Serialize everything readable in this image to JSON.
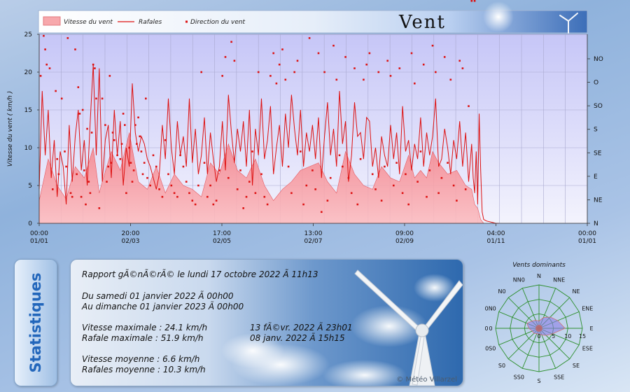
{
  "header": {
    "title": "Vent",
    "legend": {
      "speed": "Vitesse du vent",
      "gusts": "Rafales",
      "direction": "Direction du vent"
    }
  },
  "chart_data": [
    {
      "type": "area",
      "ylabel": "Vitesse du vent  ( km/h )",
      "ylim": [
        0,
        25
      ],
      "y_ticks": [
        0,
        5,
        10,
        15,
        20,
        25
      ],
      "x_ticks": [
        {
          "time": "00:00",
          "date": "01/01"
        },
        {
          "time": "20:00",
          "date": "02/03"
        },
        {
          "time": "17:00",
          "date": "02/05"
        },
        {
          "time": "13:00",
          "date": "02/07"
        },
        {
          "time": "09:00",
          "date": "02/09"
        },
        {
          "time": "04:00",
          "date": "01/11"
        },
        {
          "time": "00:00",
          "date": "01/01"
        }
      ],
      "right_axis_ticks": [
        "N",
        "NE",
        "E",
        "SE",
        "S",
        "SO",
        "O",
        "NO"
      ],
      "grid": true,
      "legend_position": "top",
      "colors": {
        "speed_fill": "#f48a8f",
        "gusts": "#dd1111",
        "direction": "#dd1111",
        "plot_bg_top": "#c8c8f7",
        "plot_bg_bottom": "#eeeefc"
      },
      "series": [
        {
          "name": "Vitesse du vent",
          "kind": "area",
          "x_day": [
            0,
            6,
            12,
            18,
            24,
            30,
            36,
            40,
            42,
            48,
            54,
            60,
            66,
            72,
            78,
            84,
            90,
            96,
            102,
            108,
            114,
            120,
            126,
            132,
            138,
            144,
            150,
            156,
            162,
            168,
            174,
            180,
            186,
            192,
            198,
            204,
            210,
            216,
            222,
            228,
            234,
            240,
            246,
            250,
            254,
            258,
            262,
            266,
            272,
            278,
            284,
            288,
            290,
            292,
            294,
            296
          ],
          "values": [
            3.0,
            8.5,
            5.0,
            3.2,
            7.5,
            6.0,
            10.0,
            4.0,
            5.5,
            9.5,
            7.0,
            12.0,
            5.5,
            4.5,
            7.5,
            4.0,
            6.5,
            5.0,
            4.5,
            3.5,
            8.0,
            6.5,
            10.5,
            7.0,
            6.0,
            8.5,
            5.0,
            3.0,
            4.5,
            5.5,
            7.0,
            7.5,
            8.0,
            5.5,
            4.0,
            9.5,
            6.5,
            5.0,
            4.5,
            7.5,
            6.0,
            5.5,
            9.0,
            6.0,
            7.0,
            6.0,
            9.5,
            8.0,
            6.5,
            7.0,
            5.0,
            4.5,
            2.5,
            2.0,
            0.5,
            0.0
          ]
        },
        {
          "name": "Rafales",
          "kind": "line",
          "x_day": [
            0,
            2,
            4,
            6,
            8,
            10,
            12,
            14,
            16,
            18,
            20,
            22,
            24,
            26,
            28,
            30,
            32,
            34,
            36,
            38,
            40,
            42,
            44,
            46,
            48,
            50,
            52,
            54,
            56,
            58,
            60,
            62,
            64,
            66,
            68,
            70,
            72,
            74,
            76,
            78,
            80,
            82,
            84,
            86,
            88,
            90,
            92,
            94,
            96,
            98,
            100,
            102,
            104,
            106,
            108,
            110,
            112,
            114,
            116,
            118,
            120,
            122,
            124,
            126,
            128,
            130,
            132,
            134,
            136,
            138,
            140,
            142,
            144,
            146,
            148,
            150,
            152,
            154,
            156,
            158,
            160,
            162,
            164,
            166,
            168,
            170,
            172,
            174,
            176,
            178,
            180,
            182,
            184,
            186,
            188,
            190,
            192,
            194,
            196,
            198,
            200,
            202,
            204,
            206,
            208,
            210,
            212,
            214,
            216,
            218,
            220,
            222,
            224,
            226,
            228,
            230,
            232,
            234,
            236,
            238,
            240,
            242,
            244,
            246,
            248,
            250,
            252,
            254,
            256,
            258,
            260,
            262,
            264,
            266,
            268,
            270,
            272,
            274,
            276,
            278,
            280,
            282,
            284,
            286,
            288,
            289,
            290,
            291,
            292,
            293,
            294,
            295,
            296,
            298,
            300,
            302,
            304,
            306
          ],
          "values": [
            4.5,
            17.5,
            9.0,
            15.0,
            6.0,
            11.0,
            3.5,
            9.5,
            7.5,
            2.5,
            13.0,
            5.5,
            11.5,
            15.0,
            7.0,
            11.0,
            5.0,
            13.5,
            21.0,
            9.0,
            20.5,
            5.5,
            11.0,
            13.0,
            6.0,
            15.0,
            9.0,
            13.5,
            5.0,
            10.0,
            7.5,
            18.5,
            12.0,
            9.5,
            11.5,
            10.5,
            8.5,
            7.5,
            6.0,
            4.5,
            6.5,
            13.0,
            8.5,
            16.5,
            10.0,
            6.5,
            13.5,
            9.0,
            11.5,
            7.5,
            16.5,
            8.0,
            12.5,
            6.5,
            9.0,
            14.0,
            6.5,
            12.0,
            8.5,
            5.5,
            7.5,
            13.5,
            7.0,
            17.0,
            12.0,
            8.0,
            12.5,
            9.5,
            13.5,
            7.5,
            15.0,
            5.0,
            12.5,
            9.0,
            16.5,
            8.5,
            11.0,
            15.5,
            6.5,
            10.0,
            13.0,
            7.5,
            14.5,
            10.0,
            17.0,
            12.5,
            9.0,
            15.0,
            7.5,
            12.0,
            9.5,
            13.0,
            8.5,
            14.0,
            6.0,
            11.5,
            16.0,
            9.0,
            12.5,
            7.5,
            17.5,
            10.5,
            13.5,
            5.5,
            9.0,
            16.0,
            11.5,
            12.0,
            8.5,
            14.0,
            13.5,
            7.5,
            10.0,
            6.0,
            11.5,
            9.0,
            7.5,
            13.0,
            8.5,
            12.0,
            6.5,
            15.5,
            9.5,
            11.0,
            7.0,
            10.5,
            8.5,
            14.0,
            7.5,
            12.0,
            9.0,
            11.5,
            16.5,
            7.5,
            8.5,
            12.5,
            10.0,
            6.5,
            11.0,
            8.5,
            13.5,
            7.5,
            12.0,
            5.5,
            10.5,
            6.0,
            4.0,
            9.5,
            2.5,
            14.5,
            7.0,
            1.5,
            0.5,
            0.3,
            0.2,
            0.1,
            0.0,
            0.0
          ]
        },
        {
          "name": "Direction du vent",
          "kind": "scatter",
          "x_day": [
            1,
            3,
            4,
            5,
            7,
            9,
            11,
            12,
            13,
            15,
            17,
            18,
            19,
            21,
            22,
            24,
            25,
            26,
            27,
            28,
            29,
            30,
            31,
            32,
            33,
            34,
            35,
            36,
            37,
            38,
            40,
            42,
            44,
            45,
            46,
            47,
            48,
            49,
            50,
            52,
            54,
            55,
            56,
            57,
            58,
            60,
            61,
            62,
            63,
            64,
            65,
            66,
            67,
            68,
            69,
            70,
            71,
            72,
            74,
            76,
            78,
            80,
            82,
            84,
            86,
            88,
            90,
            92,
            94,
            96,
            98,
            100,
            102,
            104,
            106,
            108,
            110,
            112,
            114,
            116,
            118,
            120,
            122,
            124,
            126,
            128,
            130,
            132,
            134,
            136,
            138,
            140,
            142,
            144,
            146,
            148,
            150,
            152,
            154,
            156,
            158,
            160,
            162,
            164,
            166,
            168,
            170,
            172,
            174,
            176,
            178,
            180,
            182,
            184,
            186,
            188,
            190,
            192,
            194,
            196,
            198,
            200,
            202,
            204,
            206,
            208,
            210,
            212,
            214,
            216,
            218,
            220,
            222,
            224,
            226,
            228,
            230,
            232,
            234,
            236,
            238,
            240,
            242,
            244,
            246,
            248,
            250,
            252,
            254,
            256,
            258,
            260,
            262,
            264,
            266,
            268,
            270,
            272,
            274,
            276,
            278,
            280,
            282,
            284,
            286,
            288,
            290
          ],
          "values": [
            19.5,
            24.8,
            23.0,
            21.0,
            20.5,
            4.5,
            17.5,
            8.5,
            6.5,
            16.5,
            9.5,
            7.5,
            24.5,
            4.0,
            3.5,
            23.0,
            6.5,
            18.0,
            14.5,
            3.5,
            15.0,
            7.0,
            2.5,
            12.5,
            5.5,
            4.0,
            12.0,
            21.0,
            20.5,
            16.5,
            2.0,
            16.5,
            13.0,
            5.5,
            7.5,
            19.5,
            8.0,
            12.0,
            11.0,
            9.0,
            8.5,
            10.5,
            14.5,
            13.0,
            4.0,
            10.0,
            8.0,
            5.5,
            7.0,
            13.0,
            10.5,
            14.0,
            11.5,
            9.5,
            6.5,
            8.0,
            16.5,
            6.0,
            5.0,
            9.0,
            7.5,
            4.5,
            3.5,
            11.0,
            6.5,
            5.0,
            4.0,
            3.5,
            9.0,
            7.5,
            5.5,
            4.0,
            3.0,
            2.5,
            5.0,
            20.0,
            8.0,
            3.5,
            5.0,
            2.5,
            3.0,
            7.0,
            19.5,
            22.0,
            6.0,
            24.0,
            21.5,
            4.5,
            7.0,
            2.0,
            3.5,
            5.5,
            9.5,
            4.0,
            20.0,
            6.5,
            3.5,
            2.5,
            19.5,
            22.5,
            18.5,
            21.0,
            23.0,
            19.0,
            7.5,
            4.0,
            20.0,
            21.5,
            9.5,
            2.5,
            5.0,
            24.5,
            7.0,
            4.5,
            22.5,
            1.5,
            20.0,
            3.0,
            6.0,
            23.5,
            19.0,
            9.0,
            7.5,
            22.0,
            6.0,
            4.0,
            20.5,
            2.5,
            8.5,
            19.0,
            21.0,
            22.5,
            6.5,
            4.5,
            20.0,
            3.0,
            7.5,
            21.5,
            19.5,
            5.0,
            8.0,
            20.5,
            4.0,
            6.5,
            2.5,
            22.5,
            18.5,
            5.5,
            9.5,
            21.0,
            3.5,
            7.0,
            23.5,
            20.0,
            4.0,
            6.0,
            22.0,
            8.0,
            19.0,
            5.0,
            3.0,
            21.5,
            20.5,
            4.5,
            15.5
          ]
        }
      ]
    },
    {
      "type": "radar",
      "title": "Vents dominants",
      "directions": [
        "N",
        "NNE",
        "NE",
        "ENE",
        "E",
        "ESE",
        "SE",
        "SSE",
        "S",
        "SS0",
        "S0",
        "0S0",
        "0",
        "0N0",
        "N0",
        "NN0"
      ],
      "radial_ticks": [
        0,
        5,
        10,
        15
      ],
      "max": 15,
      "values": [
        2.5,
        4.0,
        5.5,
        7.0,
        9.0,
        5.0,
        3.5,
        2.5,
        2.0,
        2.0,
        2.5,
        2.5,
        3.5,
        4.5,
        3.5,
        3.0
      ],
      "colors": {
        "fill": "#8c7fe6",
        "stroke": "#d07070",
        "grid": "#2d8f2d",
        "core": "#d06060"
      }
    }
  ],
  "statistics": {
    "tab_label": "Statistiques",
    "report_line": "Rapport gÃ©nÃ©rÃ© le lundi 17 octobre 2022 Ã  11h13",
    "period_from": "Du samedi 01 janvier 2022 Ã  00h00",
    "period_to": "Au dimanche 01 janvier 2023 Ã  00h00",
    "max_speed_label": "Vitesse maximale : 24.1 km/h",
    "max_speed_date": "13 fÃ©vr. 2022 Ã  23h01",
    "max_gust_label": "Rafale maximale : 51.9 km/h",
    "max_gust_date": "08 janv. 2022 Ã  15h15",
    "avg_speed_label": "Vitesse moyenne : 6.6 km/h",
    "avg_gust_label": "Rafales moyenne : 10.3 km/h",
    "copyright": "© Météo Villarzel"
  }
}
